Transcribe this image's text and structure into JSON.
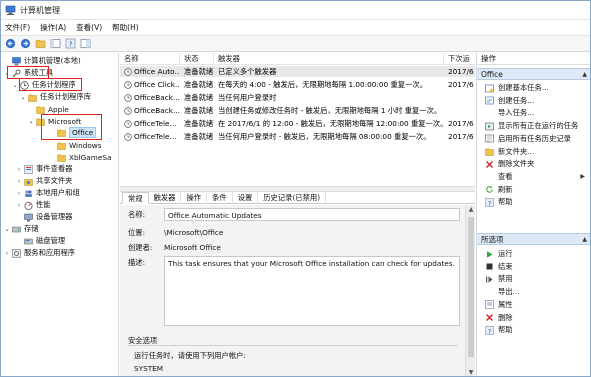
{
  "window": {
    "title": "计算机管理"
  },
  "menu": [
    "文件(F)",
    "操作(A)",
    "查看(V)",
    "帮助(H)"
  ],
  "tree": {
    "root": "计算机管理(本地)",
    "system_tools": "系统工具",
    "task_scheduler": "任务计划程序",
    "task_library": "任务计划程序库",
    "apple": "Apple",
    "microsoft": "Microsoft",
    "office": "Office",
    "windows": "Windows",
    "xbl": "XblGameSa",
    "event_viewer": "事件查看器",
    "shared_folders": "共享文件夹",
    "local_users": "本地用户和组",
    "performance": "性能",
    "device_manager": "设备管理器",
    "storage": "存储",
    "disk_mgmt": "磁盘管理",
    "services": "服务和应用程序"
  },
  "list": {
    "headers": [
      "名称",
      "状态",
      "触发器",
      "下次运"
    ],
    "rows": [
      {
        "name": "Office Auto...",
        "status": "准备就绪",
        "trigger": "已定义多个触发器",
        "next": "2017/6"
      },
      {
        "name": "Office Click...",
        "status": "准备就绪",
        "trigger": "在每天的 4:00 - 触发后，无限期地每隔 1.00:00:00 重复一次。",
        "next": "2017/6"
      },
      {
        "name": "OfficeBack...",
        "status": "准备就绪",
        "trigger": "当任何用户登录时",
        "next": ""
      },
      {
        "name": "OfficeBack...",
        "status": "准备就绪",
        "trigger": "当创建任务或修改任务时 - 触发后，无限期地每隔 1 小时 重复一次。",
        "next": ""
      },
      {
        "name": "OfficeTele...",
        "status": "准备就绪",
        "trigger": "在 2017/6/1 的 12:00 - 触发后，无限期地每隔 12:00:00 重复一次。",
        "next": "2017/6"
      },
      {
        "name": "OfficeTele...",
        "status": "准备就绪",
        "trigger": "当任何用户登录时 - 触发后，无限期地每隔 08:00:00 重复一次。",
        "next": "2017/6"
      }
    ]
  },
  "tabs": [
    "常规",
    "触发器",
    "操作",
    "条件",
    "设置",
    "历史记录(已禁用)"
  ],
  "details": {
    "name_label": "名称:",
    "name_value": "Office Automatic Updates",
    "location_label": "位置:",
    "location_value": "\\Microsoft\\Office",
    "author_label": "创建者:",
    "author_value": "Microsoft Office",
    "desc_label": "描述:",
    "desc_value": "This task ensures that your Microsoft Office installation can check for updates.",
    "security_label": "安全选项",
    "run_as_label": "运行任务时，请使用下列用户帐户:",
    "run_as_value": "SYSTEM"
  },
  "actions": {
    "header": "操作",
    "section1": "Office",
    "section1_items": [
      {
        "icon": "create-basic-task-icon",
        "label": "创建基本任务..."
      },
      {
        "icon": "create-task-icon",
        "label": "创建任务..."
      },
      {
        "icon": "",
        "label": "导入任务..."
      },
      {
        "icon": "show-running-icon",
        "label": "显示所有正在运行的任务"
      },
      {
        "icon": "enable-history-icon",
        "label": "启用所有任务历史记录"
      },
      {
        "icon": "new-folder-icon",
        "label": "新文件夹..."
      },
      {
        "icon": "delete-folder-icon",
        "label": "删除文件夹"
      },
      {
        "icon": "",
        "label": "查看"
      },
      {
        "icon": "refresh-icon",
        "label": "刷新"
      },
      {
        "icon": "help-icon",
        "label": "帮助"
      }
    ],
    "section2": "所选项",
    "section2_items": [
      {
        "icon": "run-icon",
        "label": "运行"
      },
      {
        "icon": "end-icon",
        "label": "结束"
      },
      {
        "icon": "disable-icon",
        "label": "禁用"
      },
      {
        "icon": "",
        "label": "导出..."
      },
      {
        "icon": "properties-icon",
        "label": "属性"
      },
      {
        "icon": "delete-icon",
        "label": "删除"
      },
      {
        "icon": "help-icon",
        "label": "帮助"
      }
    ]
  }
}
